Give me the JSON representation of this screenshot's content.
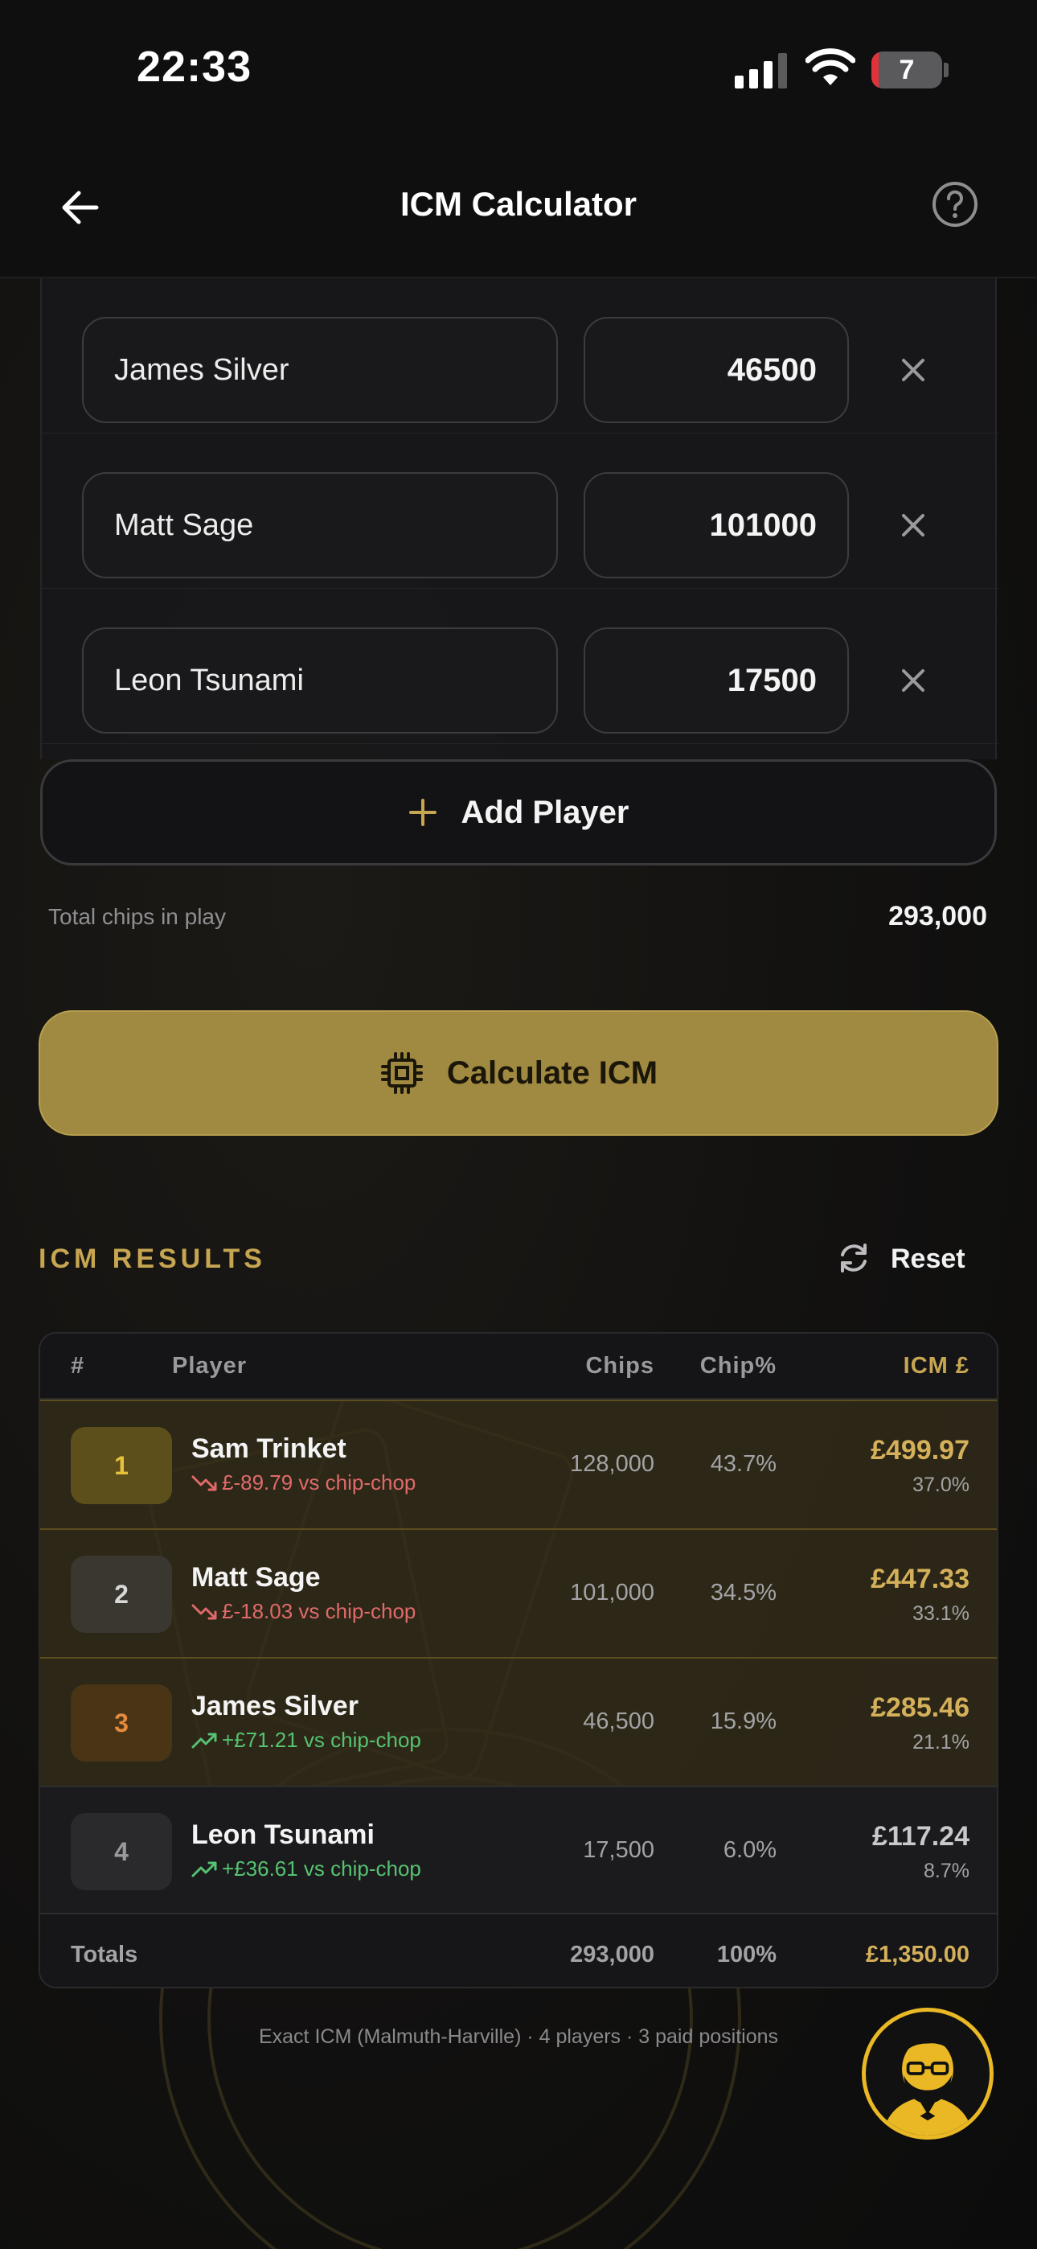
{
  "status_bar": {
    "time": "22:33",
    "battery": "7",
    "battery_level": 0.07
  },
  "header": {
    "title": "ICM Calculator"
  },
  "players": [
    {
      "name": "James Silver",
      "chips": "46500"
    },
    {
      "name": "Matt Sage",
      "chips": "101000"
    },
    {
      "name": "Leon Tsunami",
      "chips": "17500"
    }
  ],
  "add_player_label": "Add Player",
  "totals_line": {
    "label": "Total chips in play",
    "value": "293,000"
  },
  "calculate_label": "Calculate ICM",
  "results": {
    "title": "ICM RESULTS",
    "reset_label": "Reset",
    "columns": {
      "rank": "#",
      "player": "Player",
      "chips": "Chips",
      "chip_pct": "Chip%",
      "icm": "ICM £"
    },
    "rows": [
      {
        "rank": "1",
        "name": "Sam Trinket",
        "delta": "£-89.79 vs chip-chop",
        "trend": "down",
        "chips": "128,000",
        "chip_pct": "43.7%",
        "icm": "£499.97",
        "icm_pct": "37.0%"
      },
      {
        "rank": "2",
        "name": "Matt Sage",
        "delta": "£-18.03 vs chip-chop",
        "trend": "down",
        "chips": "101,000",
        "chip_pct": "34.5%",
        "icm": "£447.33",
        "icm_pct": "33.1%"
      },
      {
        "rank": "3",
        "name": "James Silver",
        "delta": "+£71.21 vs chip-chop",
        "trend": "up",
        "chips": "46,500",
        "chip_pct": "15.9%",
        "icm": "£285.46",
        "icm_pct": "21.1%"
      },
      {
        "rank": "4",
        "name": "Leon Tsunami",
        "delta": "+£36.61 vs chip-chop",
        "trend": "up",
        "chips": "17,500",
        "chip_pct": "6.0%",
        "icm": "£117.24",
        "icm_pct": "8.7%"
      }
    ],
    "totals": {
      "label": "Totals",
      "chips": "293,000",
      "chip_pct": "100%",
      "icm": "£1,350.00"
    }
  },
  "footnote": "Exact ICM (Malmuth-Harville) · 4 players · 3 paid positions",
  "colors": {
    "accent_gold": "#c7a651",
    "button_gold": "#a08940",
    "loss_red": "#e06a6a",
    "gain_green": "#56c271"
  },
  "icons": [
    "signal-icon",
    "wifi-icon",
    "battery-icon",
    "back-arrow-icon",
    "help-icon",
    "close-icon",
    "plus-icon",
    "cpu-icon",
    "refresh-icon",
    "trend-down-icon",
    "trend-up-icon",
    "avatar-icon"
  ]
}
